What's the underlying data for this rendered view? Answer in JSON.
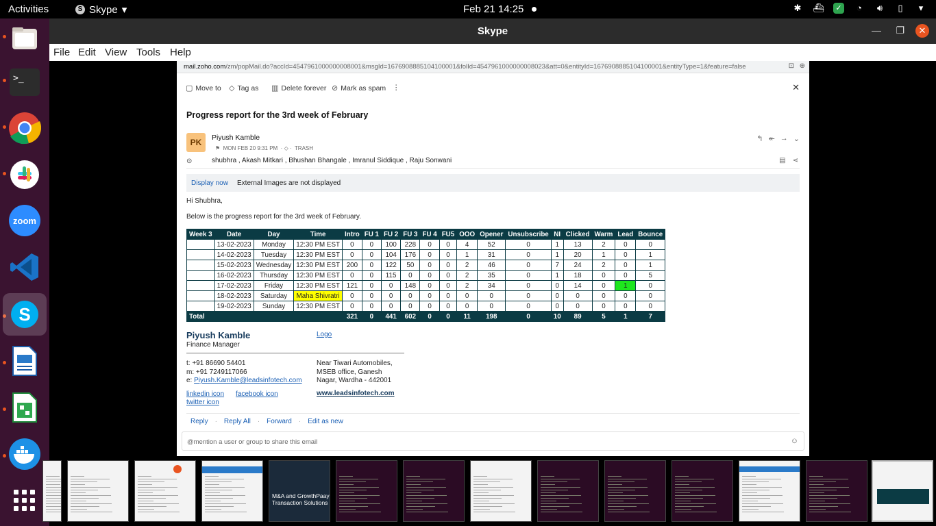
{
  "topbar": {
    "activities": "Activities",
    "app_name": "Skype",
    "clock": "Feb 21  14:25"
  },
  "window": {
    "title": "Skype",
    "menu": [
      "File",
      "Edit",
      "View",
      "Tools",
      "Help"
    ]
  },
  "url": {
    "host": "mail.zoho.com",
    "path": "/zm/popMail.do?accId=4547961000000008001&msgId=1676908885104100001&folId=4547961000000008023&att=0&entityId=1676908885104100001&entityType=1&feature=false"
  },
  "toolbar": {
    "move_to": "Move to",
    "tag_as": "Tag as",
    "delete_forever": "Delete forever",
    "mark_as_spam": "Mark as spam"
  },
  "email": {
    "subject": "Progress report for the 3rd week of February",
    "avatar_initials": "PK",
    "sender": "Piyush Kamble",
    "date": "MON FEB 20 9:31 PM",
    "folder": "TRASH",
    "recipients": "shubhra , Akash Mitkari , Bhushan Bhangale , Imranul Siddique , Raju Sonwani",
    "display_now": "Display now",
    "external_images": "External Images are not displayed",
    "greeting": "Hi Shubhra,",
    "intro": "Below is the progress report for the 3rd week of February."
  },
  "report": {
    "headers": [
      "Week 3",
      "Date",
      "Day",
      "Time",
      "Intro",
      "FU 1",
      "FU 2",
      "FU 3",
      "FU 4",
      "FU5",
      "OOO",
      "Opener",
      "Unsubscribe",
      "NI",
      "Clicked",
      "Warm",
      "Lead",
      "Bounce"
    ],
    "rows": [
      [
        "",
        "13-02-2023",
        "Monday",
        "12:30 PM EST",
        "0",
        "0",
        "100",
        "228",
        "0",
        "0",
        "4",
        "52",
        "0",
        "1",
        "13",
        "2",
        "0",
        "0"
      ],
      [
        "",
        "14-02-2023",
        "Tuesday",
        "12:30 PM EST",
        "0",
        "0",
        "104",
        "176",
        "0",
        "0",
        "1",
        "31",
        "0",
        "1",
        "20",
        "1",
        "0",
        "1"
      ],
      [
        "",
        "15-02-2023",
        "Wednesday",
        "12:30 PM EST",
        "200",
        "0",
        "122",
        "50",
        "0",
        "0",
        "2",
        "46",
        "0",
        "7",
        "24",
        "2",
        "0",
        "1"
      ],
      [
        "",
        "16-02-2023",
        "Thursday",
        "12:30 PM EST",
        "0",
        "0",
        "115",
        "0",
        "0",
        "0",
        "2",
        "35",
        "0",
        "1",
        "18",
        "0",
        "0",
        "5"
      ],
      [
        "",
        "17-02-2023",
        "Friday",
        "12:30 PM EST",
        "121",
        "0",
        "0",
        "148",
        "0",
        "0",
        "2",
        "34",
        "0",
        "0",
        "14",
        "0",
        "1",
        "0"
      ],
      [
        "",
        "18-02-2023",
        "Saturday",
        "Maha Shivratri",
        "0",
        "0",
        "0",
        "0",
        "0",
        "0",
        "0",
        "0",
        "0",
        "0",
        "0",
        "0",
        "0",
        "0"
      ],
      [
        "",
        "19-02-2023",
        "Sunday",
        "12:30 PM EST",
        "0",
        "0",
        "0",
        "0",
        "0",
        "0",
        "0",
        "0",
        "0",
        "0",
        "0",
        "0",
        "0",
        "0"
      ]
    ],
    "total": [
      "Total",
      "",
      "",
      "",
      "321",
      "0",
      "441",
      "602",
      "0",
      "0",
      "11",
      "198",
      "0",
      "10",
      "89",
      "5",
      "1",
      "7"
    ],
    "highlight_yellow": "#ffff00",
    "highlight_green": "#1ee61e"
  },
  "signature": {
    "name": "Piyush Kamble",
    "title": "Finance Manager",
    "logo_alt": "Logo",
    "phone": "t: +91 86690 54401",
    "mobile": "m: +91 7249117066",
    "email_label": "e: ",
    "email": "Piyush.Kamble@leadsinfotech.com",
    "address1": "Near Tiwari Automobiles,",
    "address2": "MSEB office, Ganesh",
    "address3": "Nagar, Wardha - 442001",
    "linkedin": "linkedin icon",
    "facebook": "facebook icon",
    "twitter": "twitter icon",
    "website": "www.leadsinfotech.com"
  },
  "actions": {
    "reply": "Reply",
    "reply_all": "Reply All",
    "forward": "Forward",
    "edit_as_new": "Edit as new"
  },
  "mention_placeholder": "@mention a user or group to share this email",
  "thumb_text": {
    "promo": "M&A and GrowthPaay Transaction Solutions"
  },
  "colors": {
    "dock_bg": "#3a1330",
    "table_header": "#0b3b44",
    "accent": "#e95420"
  }
}
